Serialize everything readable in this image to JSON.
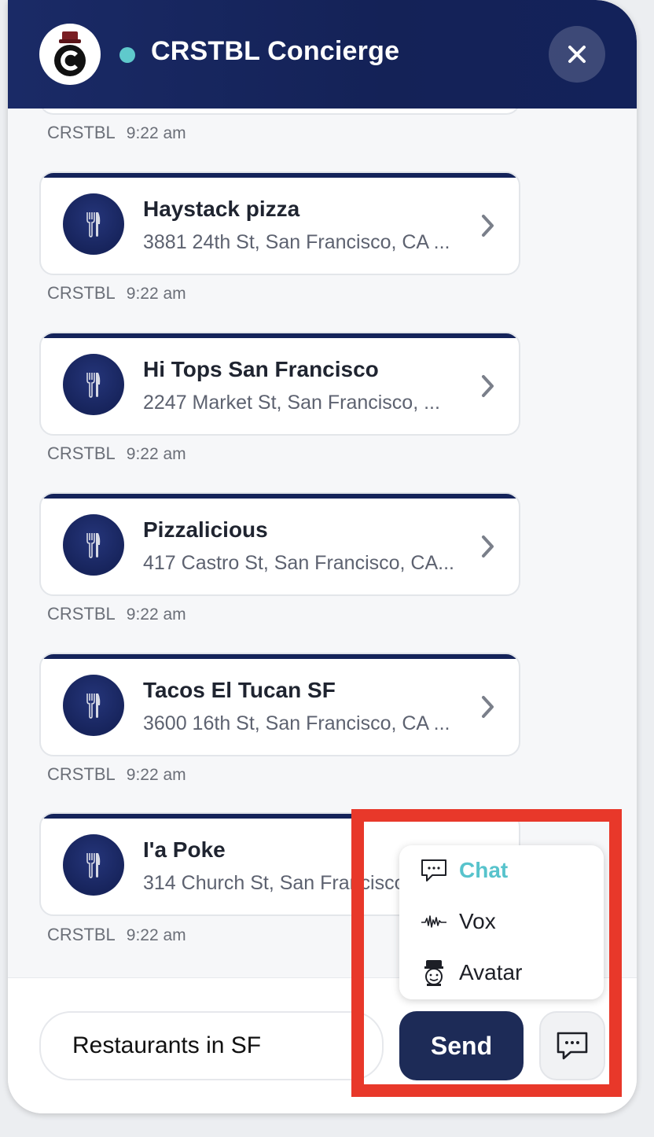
{
  "header": {
    "title": "CRSTBL Concierge",
    "close_label": "×",
    "logo_letter": "C",
    "status_color": "#5fc9cc",
    "brand_color": "#14235a"
  },
  "messages": {
    "stub_meta": {
      "sender": "CRSTBL",
      "time": "9:22 am"
    },
    "cards": [
      {
        "name": "Haystack pizza",
        "address": "3881 24th St, San Francisco, CA ...",
        "sender": "CRSTBL",
        "time": "9:22 am"
      },
      {
        "name": "Hi Tops San Francisco",
        "address": "2247 Market St, San Francisco, ...",
        "sender": "CRSTBL",
        "time": "9:22 am"
      },
      {
        "name": "Pizzalicious",
        "address": "417 Castro St, San Francisco, CA...",
        "sender": "CRSTBL",
        "time": "9:22 am"
      },
      {
        "name": "Tacos El Tucan SF",
        "address": "3600 16th St, San Francisco, CA ...",
        "sender": "CRSTBL",
        "time": "9:22 am"
      },
      {
        "name": "I'a Poke",
        "address": "314 Church St, San Francisco",
        "sender": "CRSTBL",
        "time": "9:22 am"
      }
    ]
  },
  "footer": {
    "input_value": "Restaurants in SF",
    "send_label": "Send"
  },
  "mode_menu": {
    "items": [
      {
        "label": "Chat",
        "icon": "chat-bubble-icon",
        "active": true
      },
      {
        "label": "Vox",
        "icon": "waveform-icon",
        "active": false
      },
      {
        "label": "Avatar",
        "icon": "avatar-icon",
        "active": false
      }
    ],
    "active_color": "#57c3cc"
  },
  "highlight_color": "#e8382a"
}
